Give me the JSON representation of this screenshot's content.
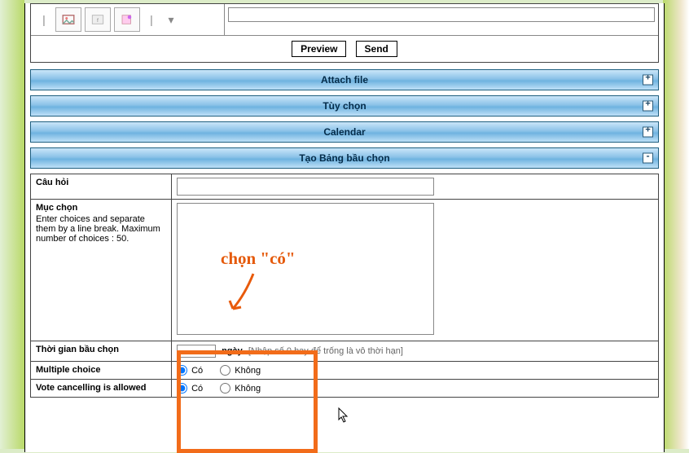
{
  "toolbar": {
    "preview_label": "Preview",
    "send_label": "Send"
  },
  "accordion": {
    "attach": "Attach file",
    "options": "Tùy chọn",
    "calendar": "Calendar",
    "poll": "Tạo Bảng bầu chọn",
    "plus": "+",
    "minus": "-"
  },
  "poll": {
    "question_label": "Câu hỏi",
    "choices_label": "Mục chọn",
    "choices_hint": "Enter choices and separate them by a line break. Maximum number of choices : 50.",
    "duration_label": "Thời gian bầu chọn",
    "days_unit": "ngày",
    "days_note": "[Nhập số 0 hay để trống là vô thời hạn]",
    "multi_label": "Multiple choice",
    "cancel_label": "Vote cancelling is allowed",
    "yes": "Có",
    "no": "Không"
  },
  "annotation": {
    "label": "chọn \"có\""
  }
}
